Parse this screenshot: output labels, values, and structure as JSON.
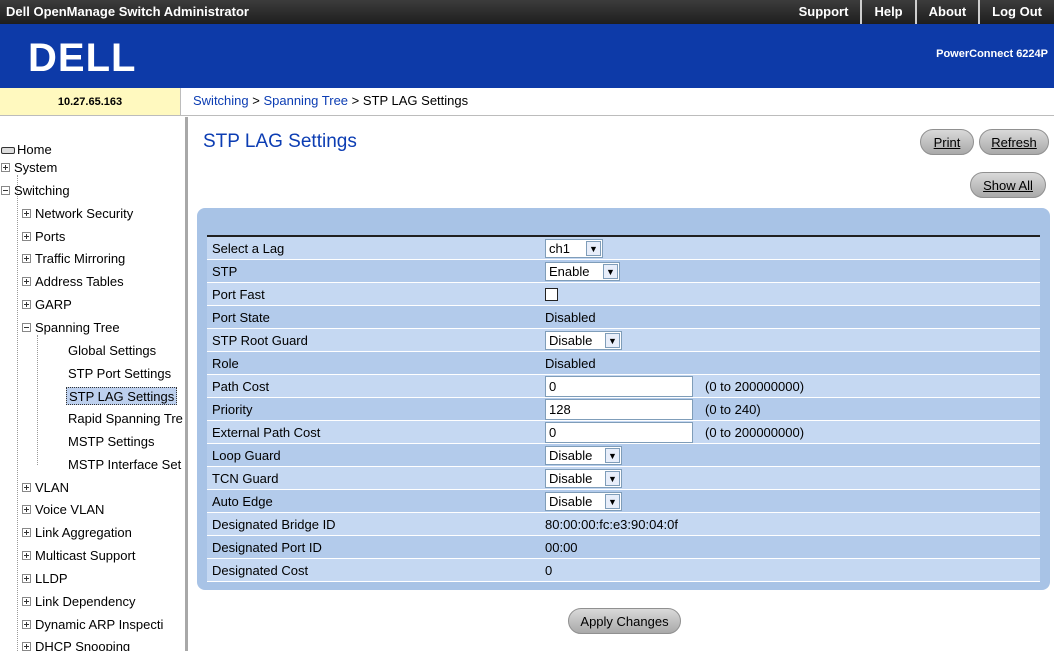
{
  "topbar": {
    "title": "Dell OpenManage Switch Administrator",
    "links": [
      "Support",
      "Help",
      "About",
      "Log Out"
    ]
  },
  "brand": {
    "logo": "DELL",
    "model": "PowerConnect 6224P"
  },
  "ip": "10.27.65.163",
  "breadcrumb": {
    "part1": "Switching",
    "sep": " > ",
    "part2": "Spanning Tree",
    "current": "STP LAG Settings"
  },
  "sidebar": {
    "home": "Home",
    "system": "System",
    "switching": "Switching",
    "network_security": "Network Security",
    "ports": "Ports",
    "traffic_mirroring": "Traffic Mirroring",
    "address_tables": "Address Tables",
    "garp": "GARP",
    "spanning_tree": "Spanning Tree",
    "global_settings": "Global Settings",
    "stp_port_settings": "STP Port Settings",
    "stp_lag_settings": "STP LAG Settings",
    "rapid_spanning_tree": "Rapid Spanning Tre",
    "mstp_settings": "MSTP Settings",
    "mstp_interface_settings": "MSTP Interface Set",
    "vlan": "VLAN",
    "voice_vlan": "Voice VLAN",
    "link_aggregation": "Link Aggregation",
    "multicast_support": "Multicast Support",
    "lldp": "LLDP",
    "link_dependency": "Link Dependency",
    "dynamic_arp": "Dynamic ARP Inspecti",
    "dhcp_snooping": "DHCP Snooping"
  },
  "page": {
    "title": "STP LAG Settings",
    "print": "Print",
    "refresh": "Refresh",
    "show_all": "Show All",
    "apply": "Apply Changes"
  },
  "form": {
    "select_lag": {
      "label": "Select a Lag",
      "value": "ch1"
    },
    "stp": {
      "label": "STP",
      "value": "Enable"
    },
    "port_fast": {
      "label": "Port Fast",
      "checked": false
    },
    "port_state": {
      "label": "Port State",
      "value": "Disabled"
    },
    "root_guard": {
      "label": "STP Root Guard",
      "value": "Disable"
    },
    "role": {
      "label": "Role",
      "value": "Disabled"
    },
    "path_cost": {
      "label": "Path Cost",
      "value": "0",
      "range": "(0 to 200000000)"
    },
    "priority": {
      "label": "Priority",
      "value": "128",
      "range": "(0 to 240)"
    },
    "ext_path_cost": {
      "label": "External Path Cost",
      "value": "0",
      "range": "(0 to 200000000)"
    },
    "loop_guard": {
      "label": "Loop Guard",
      "value": "Disable"
    },
    "tcn_guard": {
      "label": "TCN Guard",
      "value": "Disable"
    },
    "auto_edge": {
      "label": "Auto Edge",
      "value": "Disable"
    },
    "des_bridge_id": {
      "label": "Designated Bridge ID",
      "value": "80:00:00:fc:e3:90:04:0f"
    },
    "des_port_id": {
      "label": "Designated Port ID",
      "value": "00:00"
    },
    "des_cost": {
      "label": "Designated Cost",
      "value": "0"
    }
  }
}
